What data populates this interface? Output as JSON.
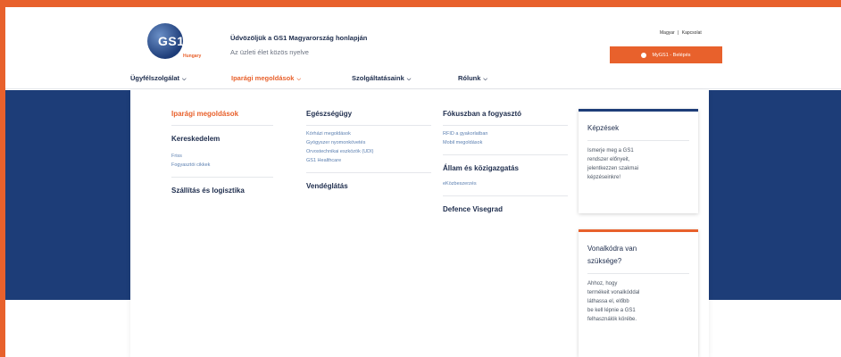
{
  "header": {
    "logo_text": "GS1",
    "logo_sub": "Hungary",
    "welcome": "Üdvözöljük a GS1 Magyarország honlapján",
    "tagline": "Az üzleti élet közös nyelve",
    "lang_hu": "Magyar",
    "lang_sep": "|",
    "lang_contact": "Kapcsolat",
    "login_label": "MyGS1 - Belépés"
  },
  "nav": {
    "items": [
      {
        "label": "Ügyfélszolgálat"
      },
      {
        "label": "Iparági megoldások"
      },
      {
        "label": "Szolgáltatásaink"
      },
      {
        "label": "Rólunk"
      }
    ]
  },
  "dropdown": {
    "col1": {
      "heading": "Iparági megoldások",
      "section1": "Kereskedelem",
      "links": [
        "Friss",
        "Fogyasztói cikkek"
      ],
      "section2": "Szállítás és logisztika"
    },
    "col2": {
      "section1": "Egészségügy",
      "links": [
        "Kórházi megoldások",
        "Gyógyszer nyomonkövetés",
        "Orvostechnikai eszközök (UDI)",
        "GS1 Healthcare"
      ],
      "section2": "Vendéglátás"
    },
    "col3": {
      "section1": "Fókuszban a fogyasztó",
      "links1": [
        "RFID a gyakorlatban",
        "Mobil megoldások"
      ],
      "section2": "Állam és közigazgatás",
      "links2": [
        "eKözbeszerzés"
      ],
      "section3": "Defence Visegrad"
    },
    "card1": {
      "title": "Képzések",
      "body_lines": [
        "Ismerje meg a GS1",
        "rendszer előnyeit,",
        "jelentkezzen szakmai",
        "képzéseinkre!"
      ]
    },
    "card2": {
      "title_lines": [
        "Vonalkódra van",
        "szüksége?"
      ],
      "body_lines": [
        "Ahhoz, hogy",
        "termékeit vonalkóddal",
        "láthassa el, előbb",
        "be kell lépnie a GS1",
        "felhasználók körébe."
      ]
    }
  },
  "colors": {
    "accent": "#e8612c",
    "navy": "#1d3d78",
    "link": "#5b7fb0"
  }
}
